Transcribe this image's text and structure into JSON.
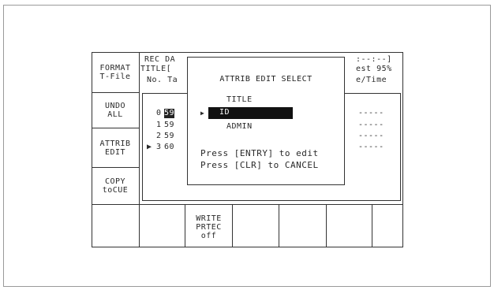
{
  "sidebar": {
    "buttons": [
      {
        "line1": "FORMAT",
        "line2": "T-File"
      },
      {
        "line1": "UNDO",
        "line2": "ALL"
      },
      {
        "line1": "ATTRIB",
        "line2": "EDIT"
      },
      {
        "line1": "COPY",
        "line2": "toCUE"
      }
    ]
  },
  "header": {
    "rec_date_label": "REC DA",
    "title_label": "TITLE[",
    "columns_label": "No. Ta",
    "time_frag": ":--:--]",
    "est_frag": "est 95%",
    "datetime_frag": "e/Time"
  },
  "list": {
    "rows": [
      {
        "marker": " ",
        "no": "0",
        "val": "59"
      },
      {
        "marker": " ",
        "no": "1",
        "val": "59"
      },
      {
        "marker": " ",
        "no": "2",
        "val": "59"
      },
      {
        "marker": "▶",
        "no": "3",
        "val": "60"
      }
    ],
    "dashes": "-----"
  },
  "dialog": {
    "title": "ATTRIB EDIT SELECT",
    "options": [
      "TITLE",
      "ID",
      "ADMIN"
    ],
    "selected_marker": "▶",
    "help1": "Press [ENTRY] to edit",
    "help2": "Press [CLR] to CANCEL"
  },
  "bottom": {
    "write_protect": {
      "line1": "WRITE",
      "line2": "PRTEC",
      "line3": "off"
    }
  }
}
